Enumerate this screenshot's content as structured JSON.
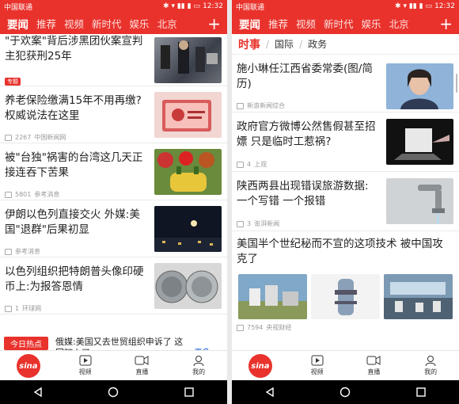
{
  "status": {
    "carrier": "中国联通",
    "time": "12:32"
  },
  "nav": {
    "tabs": [
      "要闻",
      "推荐",
      "视频",
      "新时代",
      "娱乐",
      "北京"
    ]
  },
  "sub_nav": {
    "active": "时事",
    "items": [
      "国际",
      "政务"
    ]
  },
  "left_feed": [
    {
      "title": "\"于欢案\"背后涉黑团伙案宣判 主犯获刑25年",
      "badge": "专题"
    },
    {
      "title": "养老保险缴满15年不用再缴? 权威说法在这里",
      "comments": "2267",
      "source": "中国新闻网"
    },
    {
      "title": "被\"台独\"祸害的台湾这几天正 接连吞下苦果",
      "comments": "5801",
      "source": "参考消息"
    },
    {
      "title": "伊朗以色列直接交火 外媒:美国\"退群\"后果初显",
      "source": "参考消息"
    },
    {
      "title": "以色列组织把特朗普头像印硬币上:为报答恩情",
      "comments": "1",
      "source": "环球网"
    }
  ],
  "hot": {
    "label": "今日热点",
    "text": "俄媒:美国又去世贸组织申诉了 这回盯上了…",
    "more": "更多 >"
  },
  "right_feed": [
    {
      "title": "施小琳任江西省委常委(图/简 历)",
      "source": "新浪新闻综合"
    },
    {
      "title": "政府官方微博公然售假甚至招 嫖 只是临时工惹祸?",
      "comments": "4",
      "source": "上观"
    },
    {
      "title": "陕西两县出现错误旅游数据: 一个写错 一个报错",
      "comments": "3",
      "source": "澎湃新闻"
    },
    {
      "title": "美国半个世纪秘而不宣的这项技术 被中国攻克了",
      "comments": "7594",
      "source": "央视财经"
    }
  ],
  "bottom_nav": {
    "home": "sina",
    "video": "视频",
    "live": "直播",
    "me": "我的"
  },
  "colors": {
    "accent": "#e9322c"
  }
}
